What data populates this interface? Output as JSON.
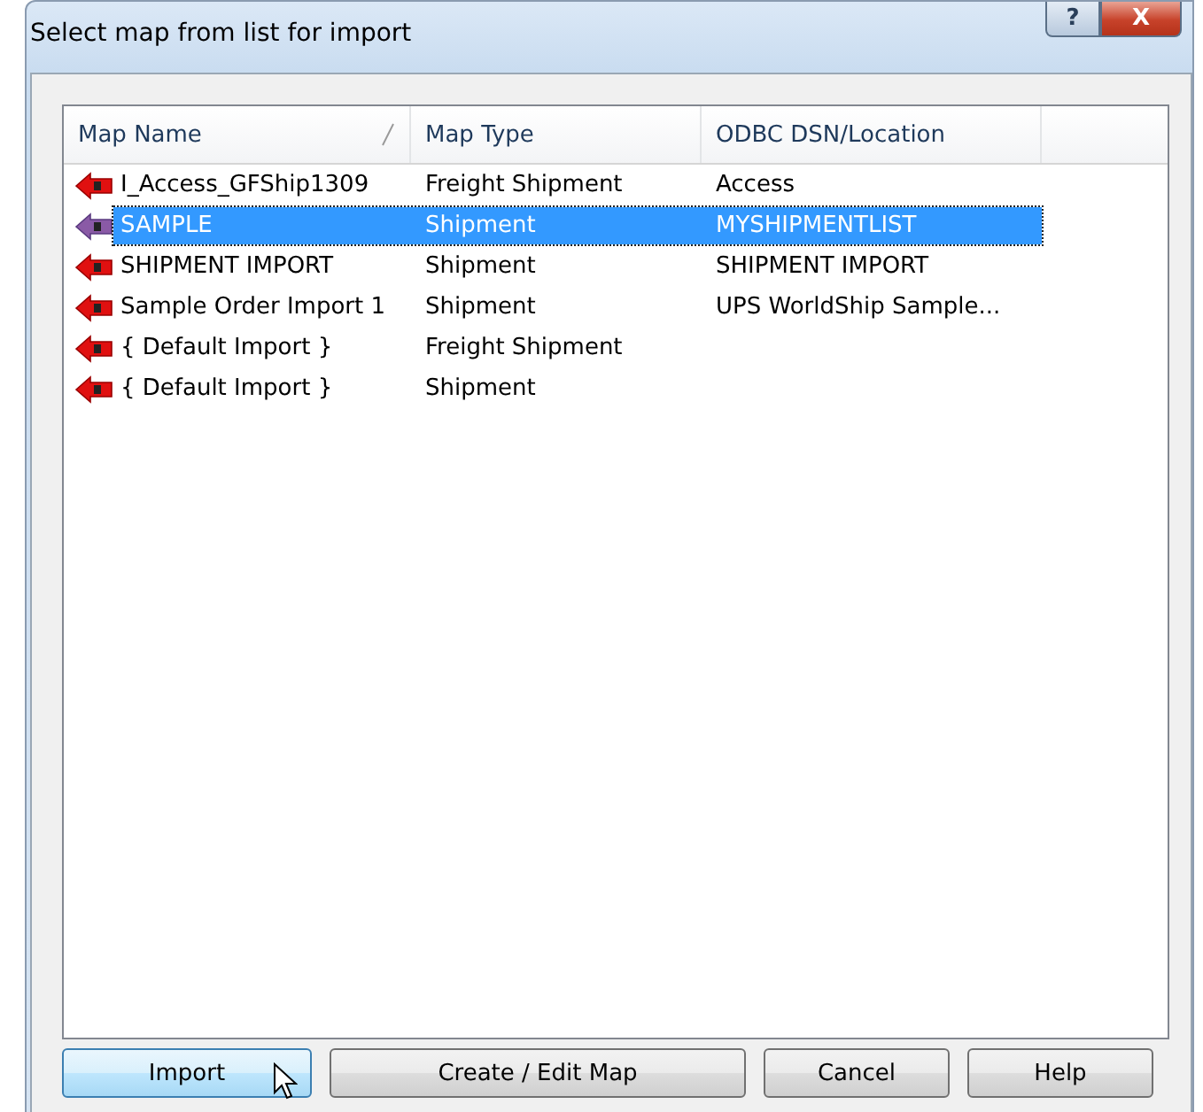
{
  "window": {
    "title": "Select map from list for import",
    "help_button": "?",
    "close_button": "X"
  },
  "table": {
    "columns": [
      {
        "label": "Map Name",
        "sorted": true
      },
      {
        "label": "Map Type",
        "sorted": false
      },
      {
        "label": "ODBC DSN/Location",
        "sorted": false
      }
    ],
    "rows": [
      {
        "cells": [
          "I_Access_GFShip1309",
          "Freight Shipment",
          "Access"
        ],
        "selected": false
      },
      {
        "cells": [
          "SAMPLE",
          "Shipment",
          "MYSHIPMENTLIST"
        ],
        "selected": true
      },
      {
        "cells": [
          "SHIPMENT IMPORT",
          "Shipment",
          "SHIPMENT IMPORT"
        ],
        "selected": false
      },
      {
        "cells": [
          "Sample Order Import 1",
          "Shipment",
          "UPS WorldShip Sample..."
        ],
        "selected": false
      },
      {
        "cells": [
          "{ Default Import }",
          "Freight Shipment",
          ""
        ],
        "selected": false
      },
      {
        "cells": [
          "{ Default Import }",
          "Shipment",
          ""
        ],
        "selected": false
      }
    ]
  },
  "buttons": [
    {
      "label": "Import",
      "hovered": true
    },
    {
      "label": "Create / Edit Map",
      "hovered": false
    },
    {
      "label": "Cancel",
      "hovered": false
    },
    {
      "label": "Help",
      "hovered": false
    }
  ]
}
